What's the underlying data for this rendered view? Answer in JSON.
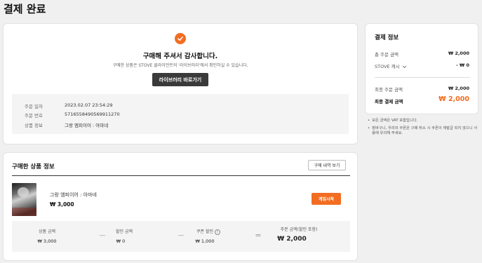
{
  "page": {
    "title": "결제 완료"
  },
  "completion": {
    "heading": "구매해 주셔서 감사합니다.",
    "subtext": "구매한 상품은 STOVE 클라이언트의 '라이브러리'에서 확인하실 수 있습니다.",
    "library_button": "라이브러리 바로가기",
    "info": [
      {
        "label": "주문 일자",
        "value": "2023.02.07 23:54:29"
      },
      {
        "label": "주문 번호",
        "value": "5716558490569911270"
      },
      {
        "label": "상품 정보",
        "value": "그랑 엠피이어 : 아마네"
      }
    ]
  },
  "purchased": {
    "section_title": "구매한 상품 정보",
    "history_button": "구매 내역 보기",
    "item": {
      "name": "그랑 엠피이어 : 아마네",
      "price": "₩ 3,000",
      "action_button": "게임시작"
    },
    "summary": {
      "product_amount": {
        "label": "상품 금액",
        "value": "₩ 3,000"
      },
      "discount": {
        "label": "할인 금액",
        "value": "₩ 0"
      },
      "coupon": {
        "label": "쿠폰 할인",
        "value": "₩ 1,000"
      },
      "order_total": {
        "label": "주문 금액(할인 포함)",
        "value": "₩ 2,000"
      },
      "minus1": "—",
      "minus2": "—",
      "equals": "="
    }
  },
  "payment": {
    "title": "결제 정보",
    "rows": [
      {
        "label": "총 주문 금액",
        "value": "₩ 2,000"
      },
      {
        "label": "STOVE 캐시",
        "value": "- ₩ 0"
      }
    ],
    "final_order": {
      "label": "최종 주문 금액",
      "value": "₩ 2,000"
    },
    "final_payment": {
      "label": "최종 결제 금액",
      "value": "₩ 2,000"
    },
    "notes": [
      "모든 금액은 VAT 포함입니다.",
      "장바구니, 우리의 쿠폰은 구매 취소 시 쿠폰이 재발급 되지 않으니 사용에 유의해 주세요."
    ]
  },
  "colors": {
    "accent": "#f26d21",
    "dark_button": "#3a3a3a",
    "background": "#f0f0f0"
  }
}
